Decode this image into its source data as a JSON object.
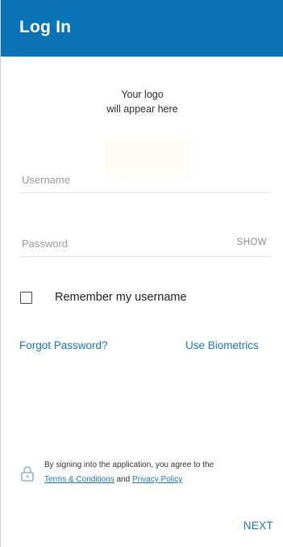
{
  "header": {
    "title": "Log In"
  },
  "logo": {
    "line1": "Your logo",
    "line2": "will appear here"
  },
  "form": {
    "username_placeholder": "Username",
    "username_value": "",
    "password_placeholder": "Password",
    "password_value": "",
    "show_label": "SHOW",
    "remember_label": "Remember my username",
    "remember_checked": false
  },
  "links": {
    "forgot_password": "Forgot Password?",
    "use_biometrics": "Use Biometrics"
  },
  "agreement": {
    "line1": "By signing into the application, you agree to the",
    "terms": "Terms & Conditions",
    "and": "and",
    "privacy": "Privacy Policy",
    "icon": "lock-icon"
  },
  "actions": {
    "next_label": "NEXT"
  },
  "colors": {
    "header_bg": "#0a73b6",
    "link": "#1a74c2"
  }
}
